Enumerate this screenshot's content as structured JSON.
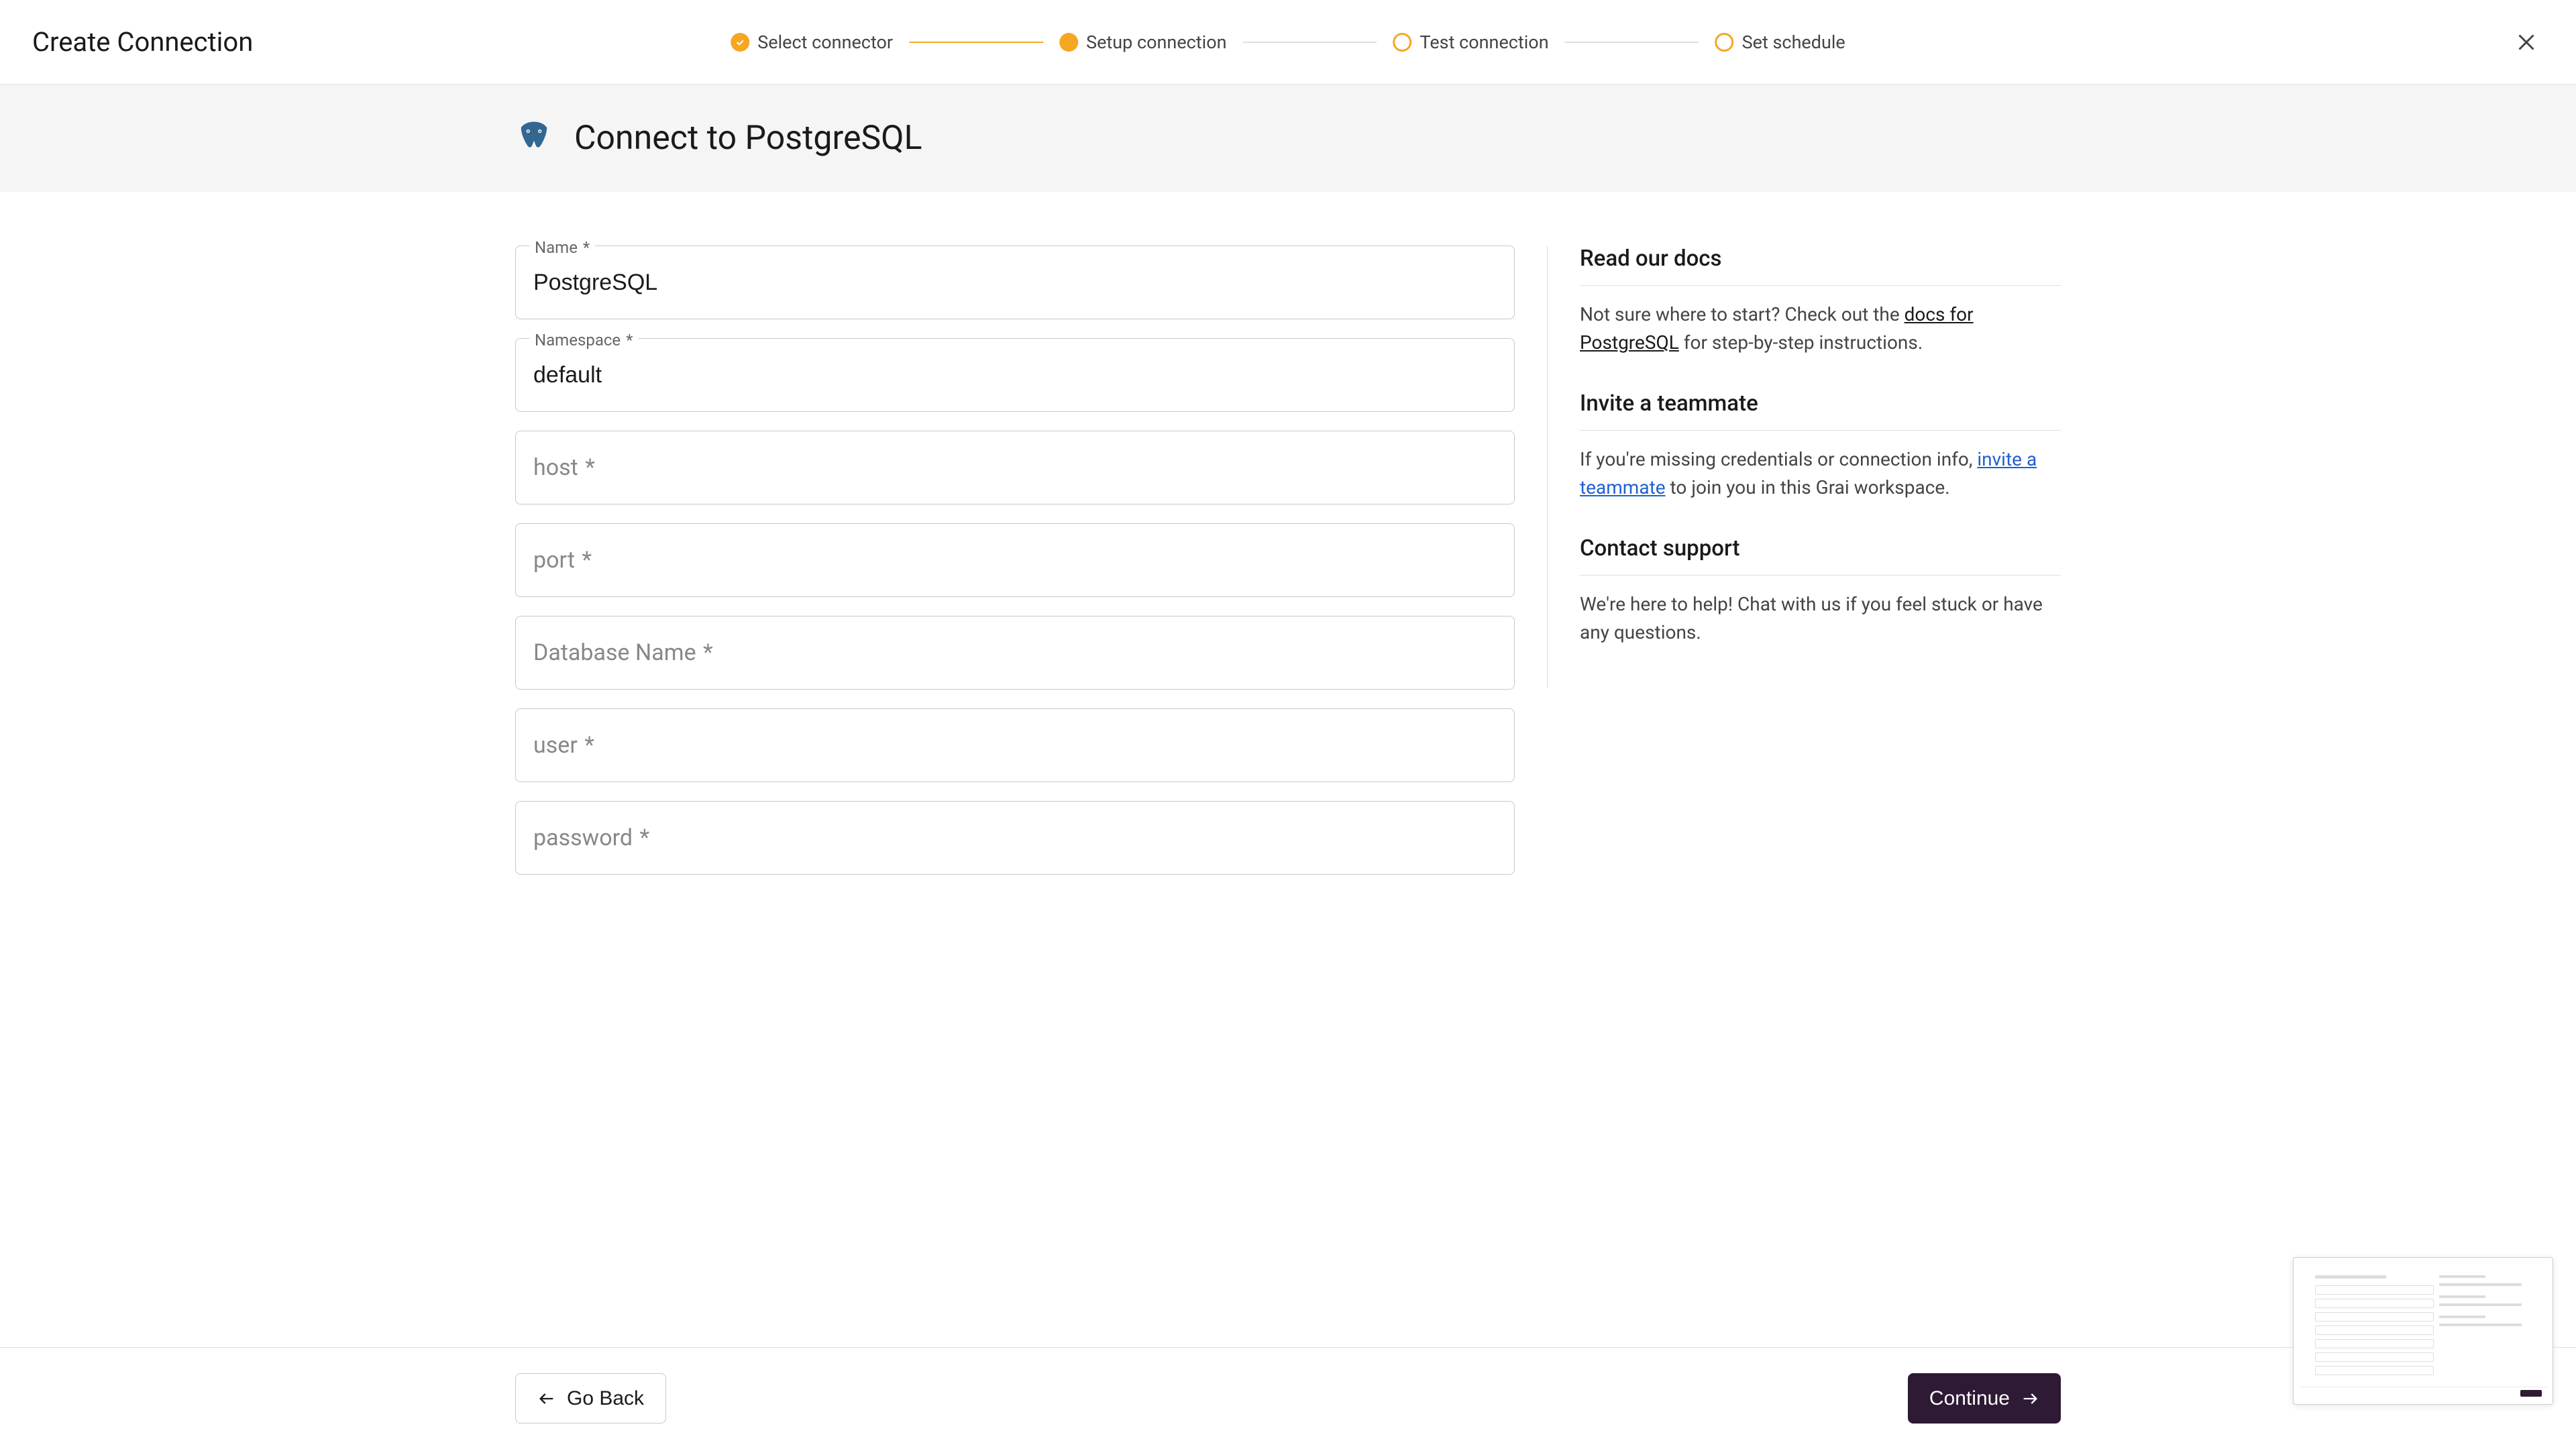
{
  "header": {
    "title": "Create Connection",
    "steps": [
      {
        "label": "Select connector",
        "state": "done"
      },
      {
        "label": "Setup connection",
        "state": "active"
      },
      {
        "label": "Test connection",
        "state": "pending"
      },
      {
        "label": "Set schedule",
        "state": "pending"
      }
    ]
  },
  "subheader": {
    "title": "Connect to PostgreSQL",
    "icon": "postgresql-icon"
  },
  "form": {
    "fields": [
      {
        "label": "Name",
        "required": true,
        "value": "PostgreSQL",
        "floating": true
      },
      {
        "label": "Namespace",
        "required": true,
        "value": "default",
        "floating": true
      },
      {
        "label": "host",
        "required": true,
        "value": "",
        "floating": false
      },
      {
        "label": "port",
        "required": true,
        "value": "",
        "floating": false
      },
      {
        "label": "Database Name",
        "required": true,
        "value": "",
        "floating": false
      },
      {
        "label": "user",
        "required": true,
        "value": "",
        "floating": false
      },
      {
        "label": "password",
        "required": true,
        "value": "",
        "floating": false
      }
    ]
  },
  "help": {
    "docs": {
      "heading": "Read our docs",
      "text_before": "Not sure where to start? Check out the ",
      "link": "docs for PostgreSQL",
      "text_after": " for step-by-step instructions."
    },
    "invite": {
      "heading": "Invite a teammate",
      "text_before": "If you're missing credentials or connection info, ",
      "link": "invite a teammate",
      "text_after": " to join you in this Grai workspace."
    },
    "support": {
      "heading": "Contact support",
      "text": "We're here to help! Chat with us if you feel stuck or have any questions."
    }
  },
  "footer": {
    "back": "Go Back",
    "continue": "Continue"
  }
}
